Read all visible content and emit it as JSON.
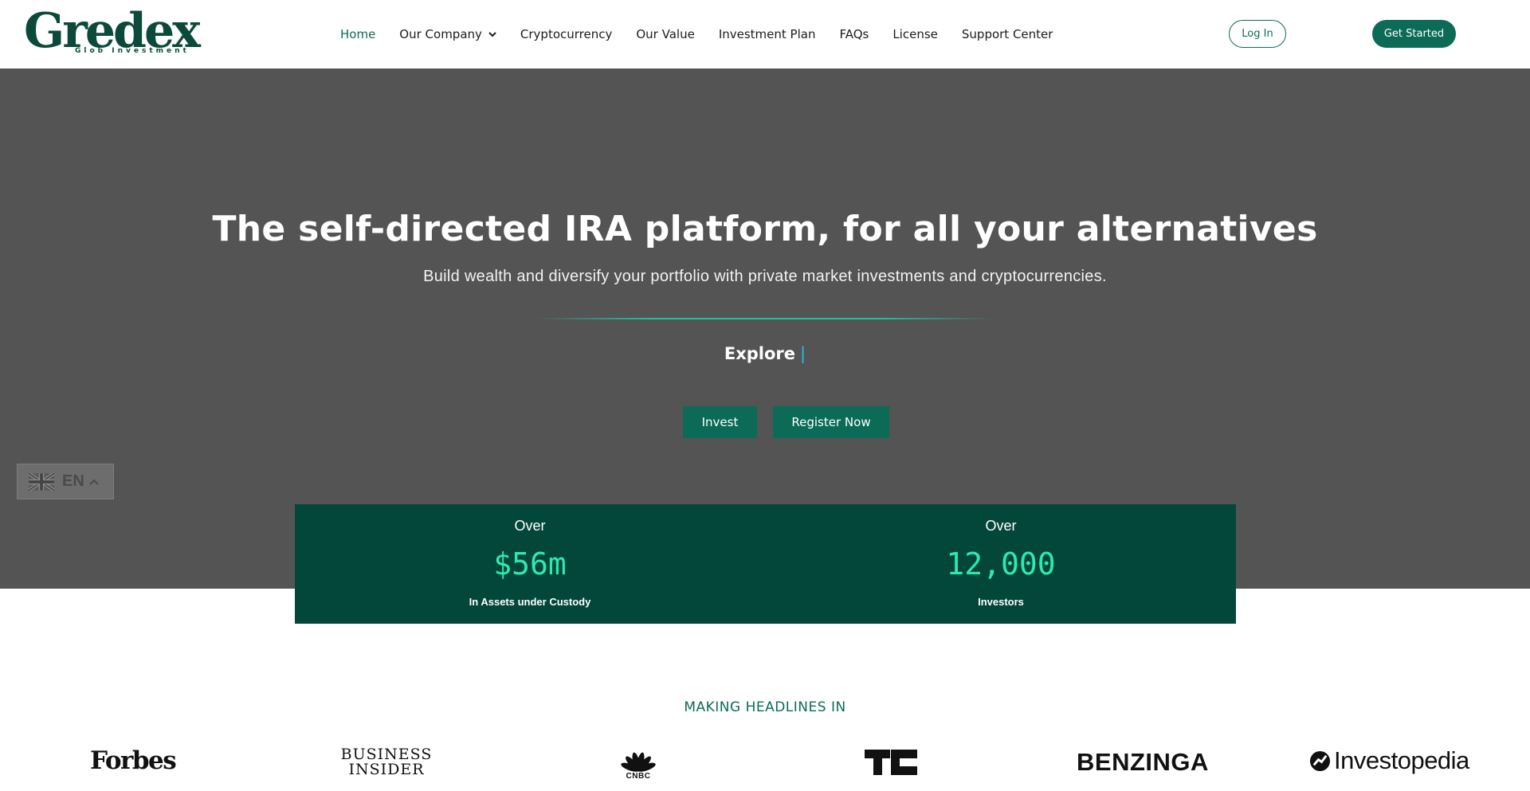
{
  "header": {
    "logo_main": "Gredex",
    "logo_sub": "Glob Investment",
    "nav": [
      {
        "label": "Home",
        "active": true
      },
      {
        "label": "Our Company",
        "dropdown": true
      },
      {
        "label": "Cryptocurrency"
      },
      {
        "label": "Our Value"
      },
      {
        "label": "Investment Plan"
      },
      {
        "label": "FAQs"
      },
      {
        "label": "License"
      },
      {
        "label": "Support Center"
      }
    ],
    "login_label": "Log In",
    "get_started_label": "Get Started"
  },
  "hero": {
    "title": "The self-directed IRA platform, for all your alternatives",
    "subtitle": "Build wealth and diversify your portfolio with private market investments and cryptocurrencies.",
    "explore": "Explore",
    "cursor": "|",
    "invest_label": "Invest",
    "register_label": "Register Now"
  },
  "language": {
    "code": "EN",
    "flag_icon": "uk-flag-icon"
  },
  "stats": [
    {
      "over": "Over",
      "value": "$56m",
      "label": "In Assets under Custody"
    },
    {
      "over": "Over",
      "value": "12,000",
      "label": "Investors"
    }
  ],
  "headlines": {
    "title": "MAKING HEADLINES IN",
    "brands": {
      "forbes": "Forbes",
      "bi_line1": "BUSINESS",
      "bi_line2": "INSIDER",
      "cnbc": "CNBC",
      "benzinga": "BENZINGA",
      "investopedia": "Investopedia"
    }
  },
  "colors": {
    "brand": "#0b6b57",
    "dark_green": "#03473b",
    "accent": "#2ee8b6",
    "hero_bg": "#545454"
  }
}
